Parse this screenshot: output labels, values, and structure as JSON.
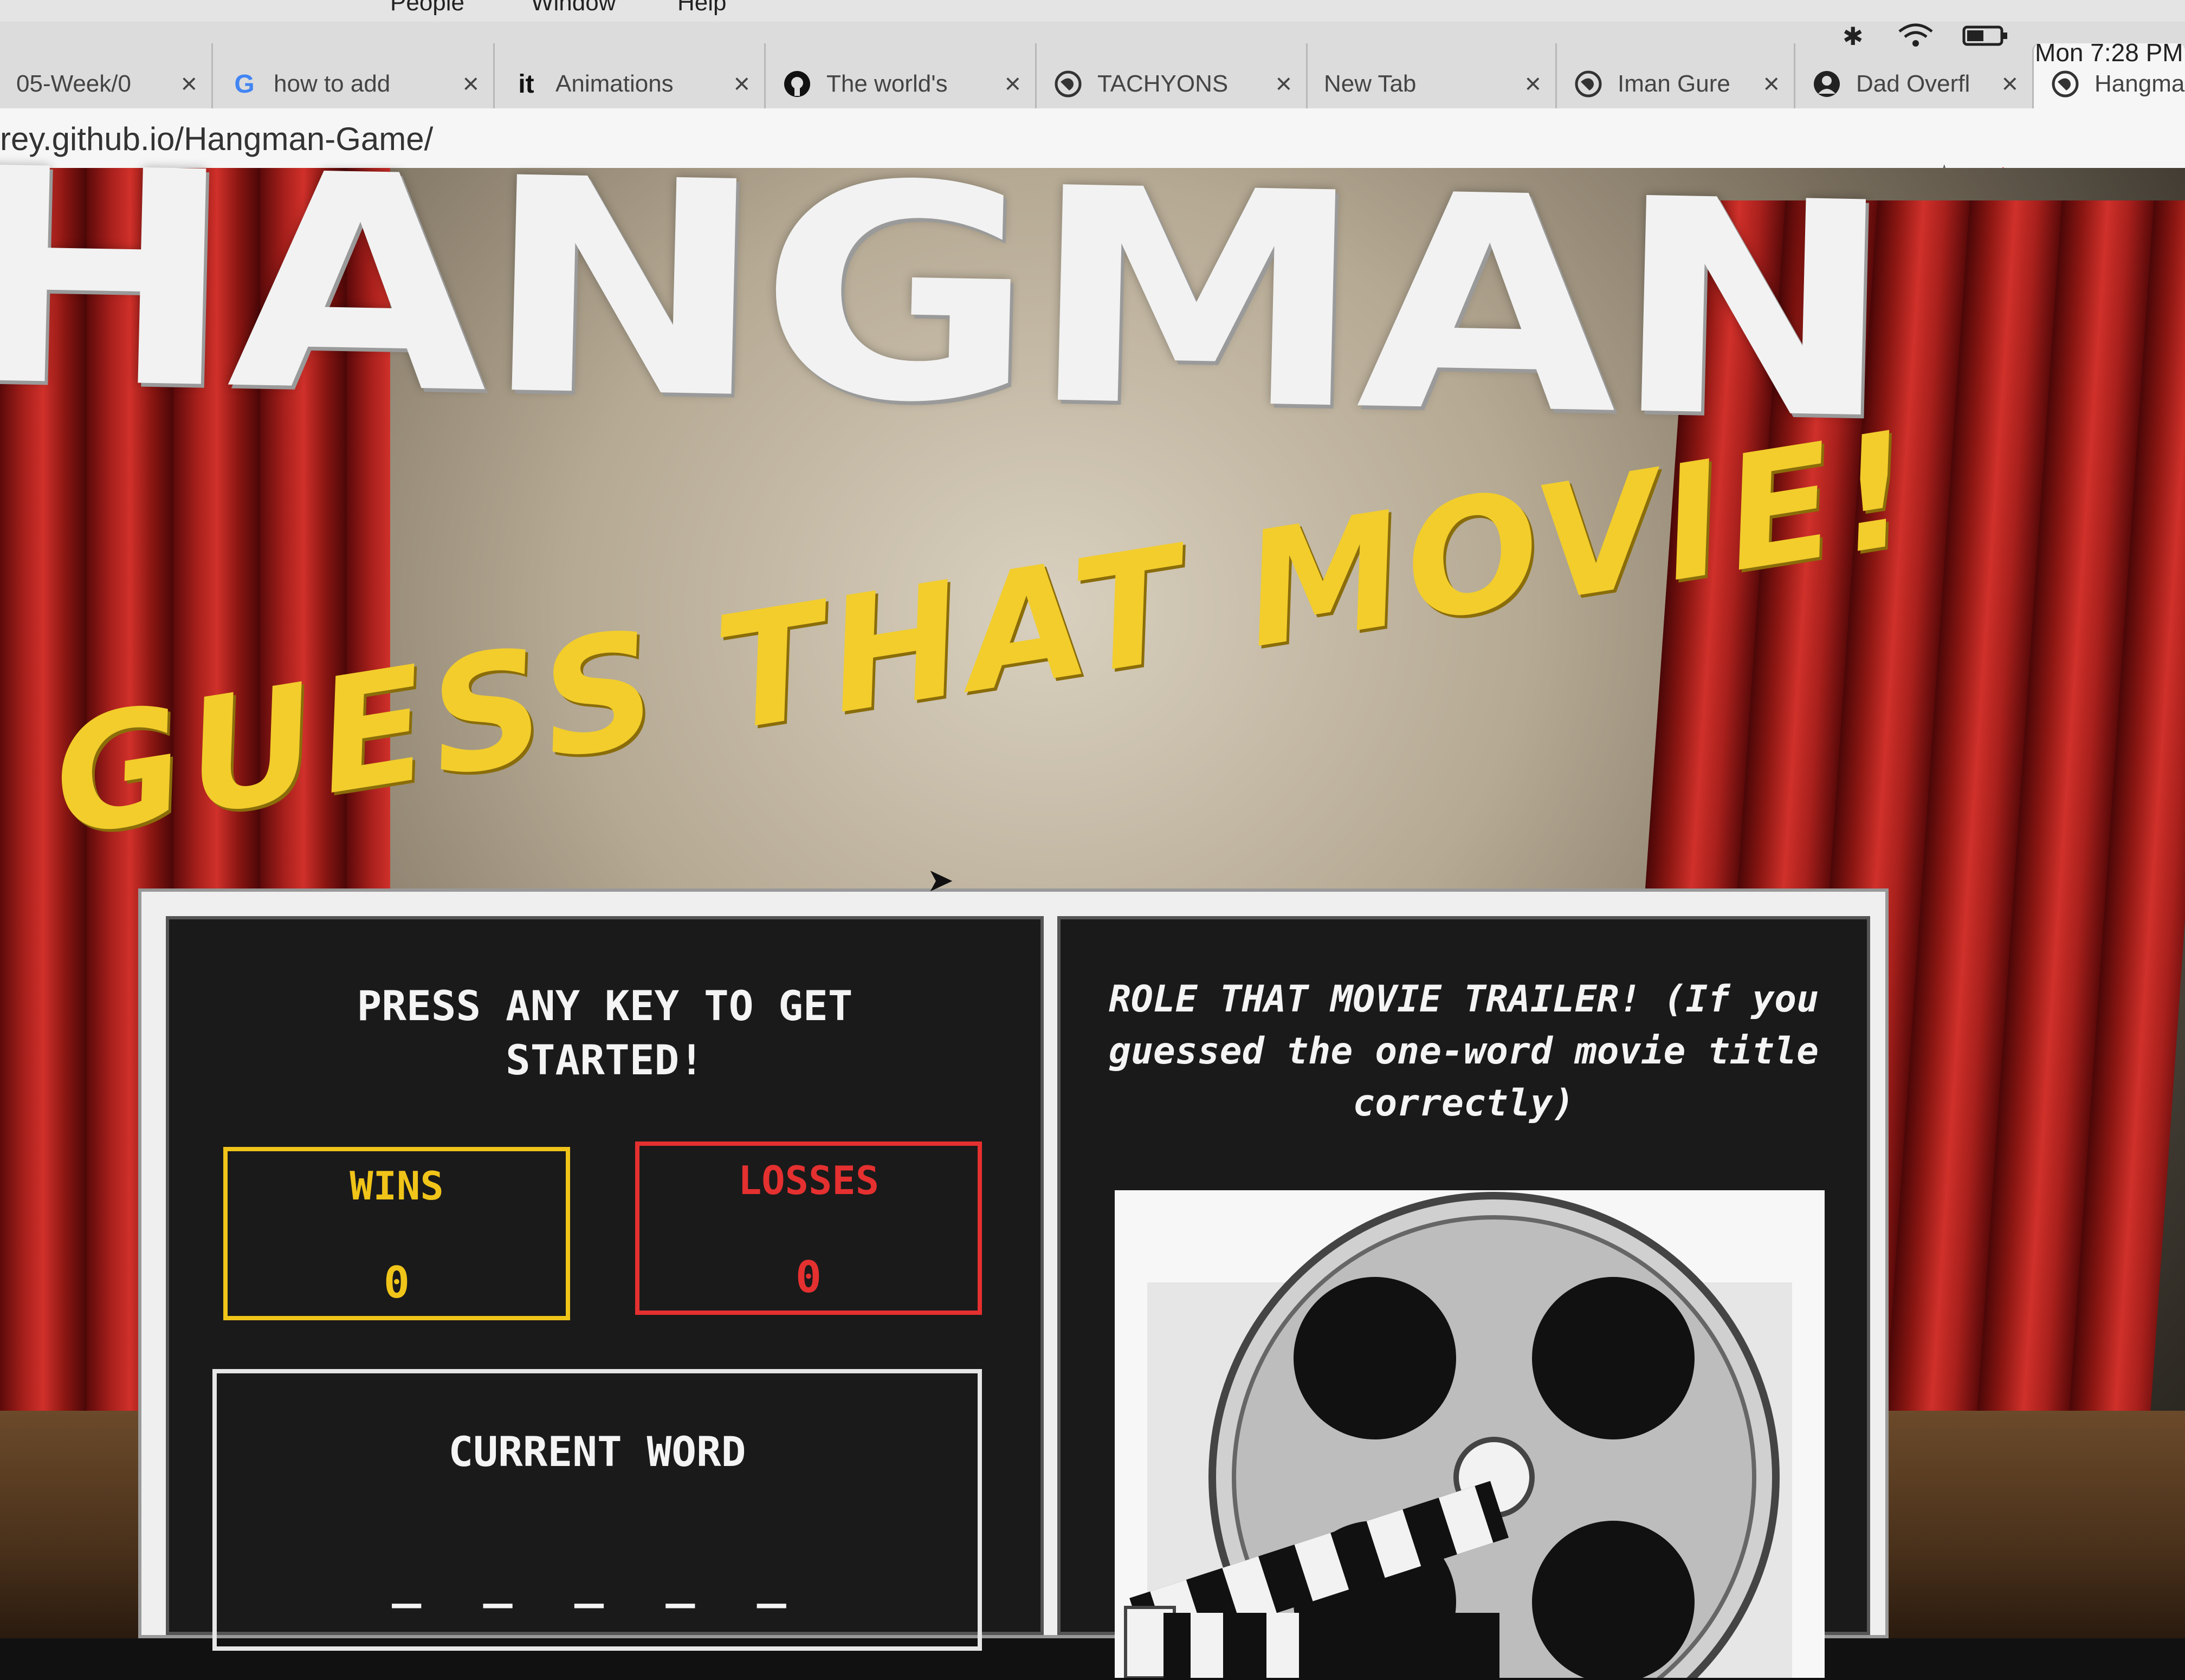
{
  "menubar": {
    "items": [
      "People",
      "Window",
      "Help"
    ]
  },
  "tabs": [
    {
      "label": "05-Week/0",
      "icon": "doc-icon"
    },
    {
      "label": "how to add",
      "icon": "google-icon"
    },
    {
      "label": "Animations",
      "icon": "it-icon"
    },
    {
      "label": "The world's",
      "icon": "github-icon"
    },
    {
      "label": "TACHYONS",
      "icon": "globe-icon"
    },
    {
      "label": "New Tab",
      "icon": ""
    },
    {
      "label": "Iman Gure",
      "icon": "globe-icon"
    },
    {
      "label": "Dad Overfl",
      "icon": "avatar-icon"
    },
    {
      "label": "Hangma",
      "icon": "globe-icon"
    }
  ],
  "status": {
    "clock": "Mon 7:28 PM"
  },
  "address_bar": {
    "url": "rey.github.io/Hangman-Game/"
  },
  "page": {
    "title": "HANGMAN",
    "subtitle": "GUESS THAT MOVIE!",
    "prompt": "PRESS ANY KEY TO GET STARTED!",
    "wins_label": "WINS",
    "wins_value": "0",
    "losses_label": "LOSSES",
    "losses_value": "0",
    "current_word_label": "CURRENT WORD",
    "current_word_blanks": "_ _ _ _ _",
    "trailer_heading": "ROLE THAT MOVIE TRAILER! (If you guessed the one-word movie title correctly)"
  },
  "colors": {
    "wins": "#f0c419",
    "losses": "#e53030",
    "subtitle": "#f2cd2c",
    "curtain": "#b3221c"
  }
}
